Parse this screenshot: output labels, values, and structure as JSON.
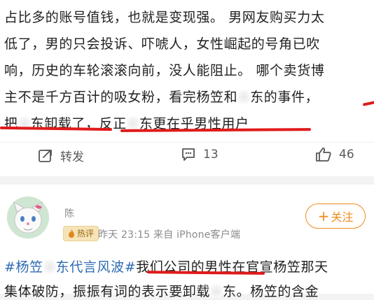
{
  "post1": {
    "lines": [
      "占比多的账号值钱，也就是变现强。 男网友购买力太",
      "低了，男的只会投诉、吓唬人，女性崛起的号角已吹",
      "响，历史的车轮滚滚向前，没人能阻止。 哪个卖货博",
      [
        "主不是千方百计的吸女粉，看完杨笠和",
        "东的事件，"
      ],
      [
        "把",
        "东卸载了，反正",
        "东更在乎男性用户"
      ]
    ],
    "actions": {
      "repost_label": "转发",
      "comment_count": "13",
      "like_count": "46"
    }
  },
  "post2": {
    "username": "陈",
    "badge": "热评",
    "meta": "昨天 23:15  来自 iPhone客户端",
    "follow_label": "关注",
    "line1": [
      "#杨笠",
      "东代言风波#",
      "我们公司的男性在官宣杨笠那天"
    ],
    "line2": [
      "集体破防，振振有词的表示要卸载",
      "东。杨笠的含金"
    ]
  },
  "colors": {
    "highlight": "#e01a1a",
    "topic": "#2f6bb3",
    "follow": "#f08a1c"
  }
}
